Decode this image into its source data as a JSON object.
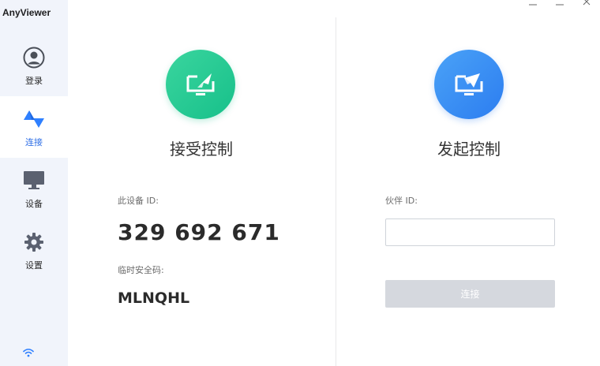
{
  "app": {
    "title": "AnyViewer"
  },
  "sidebar": {
    "items": [
      {
        "id": "login",
        "label": "登录",
        "icon": "user-circle-icon",
        "active": false
      },
      {
        "id": "connect",
        "label": "连接",
        "icon": "connect-arrows-icon",
        "active": true
      },
      {
        "id": "devices",
        "label": "设备",
        "icon": "monitor-icon",
        "active": false
      },
      {
        "id": "settings",
        "label": "设置",
        "icon": "gear-icon",
        "active": false
      }
    ],
    "status_icon": "wifi-icon"
  },
  "window_controls": {
    "icons": [
      "minimize-icon",
      "maximize-icon",
      "close-icon"
    ]
  },
  "accept_panel": {
    "title": "接受控制",
    "icon": "screen-share-icon",
    "device_id_label": "此设备 ID:",
    "device_id": "329 692 671",
    "temp_code_label": "临时安全码:",
    "temp_code": "MLNQHL"
  },
  "initiate_panel": {
    "title": "发起控制",
    "icon": "remote-control-icon",
    "partner_id_label": "伙伴 ID:",
    "partner_id_value": "",
    "connect_label": "连接"
  },
  "colors": {
    "accent": "#2f6fe6",
    "accept_icon_bg": "#25c893",
    "initiate_icon_bg": "#3a8ef4",
    "sidebar_bg": "#f1f4fb",
    "disabled_button": "#d5d8de"
  }
}
